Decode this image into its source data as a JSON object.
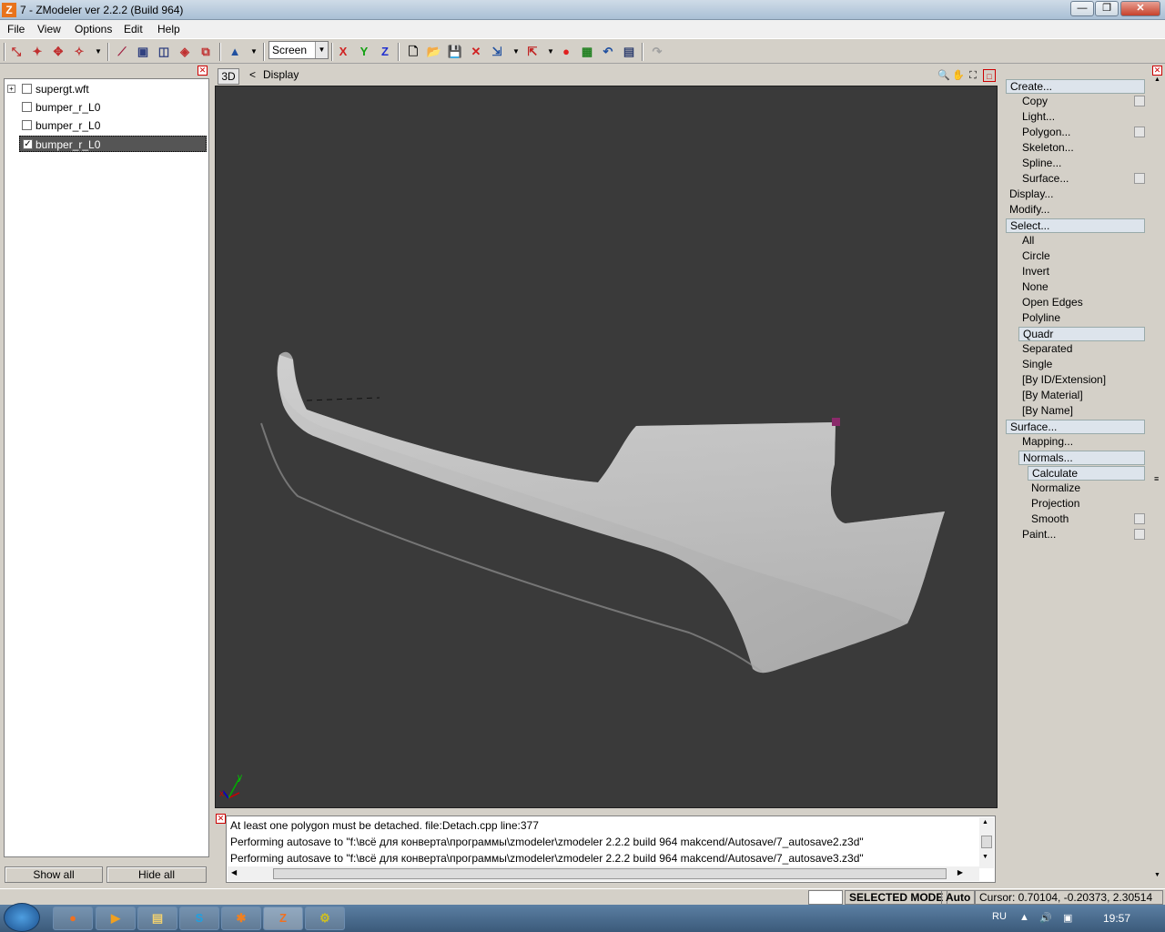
{
  "window": {
    "title": "7 - ZModeler ver 2.2.2 (Build 964)",
    "app_icon": "Z",
    "min": "—",
    "max": "❐",
    "close": "✕"
  },
  "menu": [
    "File",
    "View",
    "Options",
    "Edit",
    "Help"
  ],
  "toolbar": {
    "space_select": "Screen",
    "axis_x": "X",
    "axis_y": "Y",
    "axis_z": "Z"
  },
  "tree": {
    "items": [
      {
        "label": "supergt.wft",
        "expand": "+",
        "checked": ""
      },
      {
        "label": "bumper_r_L0",
        "checked": ""
      },
      {
        "label": "bumper_r_L0",
        "checked": ""
      },
      {
        "label": "bumper_r_L0",
        "checked": "✓"
      }
    ],
    "show_all": "Show all",
    "hide_all": "Hide all"
  },
  "viewport": {
    "mode": "3D",
    "nav": "<",
    "title": "Display",
    "axis_y": "y",
    "axis_x": "x"
  },
  "console": {
    "lines": [
      "At least one polygon must be detached. file:Detach.cpp line:377",
      "Performing autosave to \"f:\\всё для конверта\\программы\\zmodeler\\zmodeler 2.2.2 build 964 makcend/Autosave/7_autosave2.z3d\"",
      "Performing autosave to \"f:\\всё для конверта\\программы\\zmodeler\\zmodeler 2.2.2 build 964 makcend/Autosave/7_autosave3.z3d\""
    ]
  },
  "commands": [
    {
      "label": "Create...",
      "level": 0,
      "hl": true
    },
    {
      "label": "Copy",
      "level": 1,
      "box": true
    },
    {
      "label": "Light...",
      "level": 1
    },
    {
      "label": "Polygon...",
      "level": 1,
      "box": true
    },
    {
      "label": "Skeleton...",
      "level": 1
    },
    {
      "label": "Spline...",
      "level": 1
    },
    {
      "label": "Surface...",
      "level": 1,
      "box": true
    },
    {
      "label": "Display...",
      "level": 0
    },
    {
      "label": "Modify...",
      "level": 0
    },
    {
      "label": "Select...",
      "level": 0,
      "hl": true
    },
    {
      "label": "All",
      "level": 1
    },
    {
      "label": "Circle",
      "level": 1
    },
    {
      "label": "Invert",
      "level": 1
    },
    {
      "label": "None",
      "level": 1
    },
    {
      "label": "Open Edges",
      "level": 1
    },
    {
      "label": "Polyline",
      "level": 1
    },
    {
      "label": "Quadr",
      "level": 1,
      "hl": true
    },
    {
      "label": "Separated",
      "level": 1
    },
    {
      "label": "Single",
      "level": 1
    },
    {
      "label": "[By ID/Extension]",
      "level": 1
    },
    {
      "label": "[By Material]",
      "level": 1
    },
    {
      "label": "[By Name]",
      "level": 1
    },
    {
      "label": "Surface...",
      "level": 0,
      "hl": true
    },
    {
      "label": "Mapping...",
      "level": 1
    },
    {
      "label": "Normals...",
      "level": 1,
      "hl": true
    },
    {
      "label": "Calculate",
      "level": 2,
      "hl": true
    },
    {
      "label": "Normalize",
      "level": 2
    },
    {
      "label": "Projection",
      "level": 2
    },
    {
      "label": "Smooth",
      "level": 2,
      "box": true
    },
    {
      "label": "Paint...",
      "level": 1,
      "box": true
    }
  ],
  "status": {
    "mode": "SELECTED MODE",
    "auto": "Auto",
    "cursor": "Cursor: 0.70104, -0.20373, 2.30514"
  },
  "taskbar": {
    "lang": "RU",
    "clock": "19:57"
  },
  "colors": {
    "viewport_bg": "#3a3a3a",
    "panel": "#d4d0c8",
    "model": "#c4c4c4"
  }
}
